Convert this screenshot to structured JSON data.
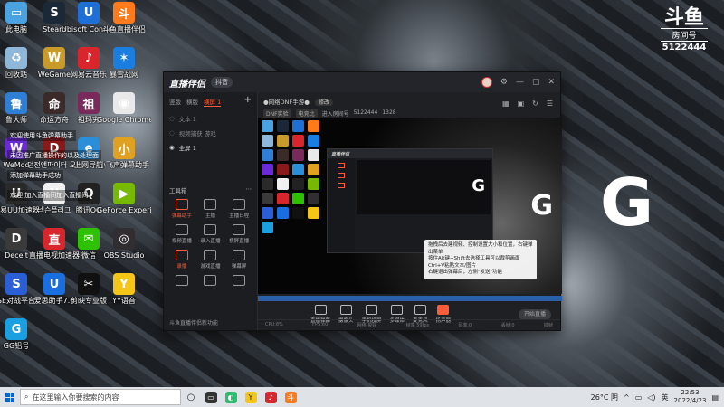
{
  "desktop_icons": [
    {
      "label": "此电脑",
      "glyph": "▭",
      "color": "#4aa3e0"
    },
    {
      "label": "Steam",
      "glyph": "S",
      "color": "#1b2838"
    },
    {
      "label": "Ubisoft Connect",
      "glyph": "U",
      "color": "#1e6fd6"
    },
    {
      "label": "斗鱼直播伴侣",
      "glyph": "斗",
      "color": "#ff7a1a"
    },
    {
      "label": "回收站",
      "glyph": "♻",
      "color": "#8fb7d9"
    },
    {
      "label": "WeGame",
      "glyph": "W",
      "color": "#c79a2a"
    },
    {
      "label": "网易云音乐",
      "glyph": "♪",
      "color": "#d8262c"
    },
    {
      "label": "暴雪战网",
      "glyph": "✶",
      "color": "#1a7ee0"
    },
    {
      "label": "鲁大师",
      "glyph": "鲁",
      "color": "#2f7fd6"
    },
    {
      "label": "命运方舟",
      "glyph": "命",
      "color": "#3a2a2a"
    },
    {
      "label": "祖玛究",
      "glyph": "祖",
      "color": "#7a2a5a"
    },
    {
      "label": "Google Chrome",
      "glyph": "◉",
      "color": "#e9e9e9"
    },
    {
      "label": "WeMod",
      "glyph": "W",
      "color": "#6a2ad8"
    },
    {
      "label": "던전앤파이터 오버잘",
      "glyph": "D",
      "color": "#8a1a1a"
    },
    {
      "label": "上网导航",
      "glyph": "e",
      "color": "#2a8fd8"
    },
    {
      "label": "小飞声弹幕助手",
      "glyph": "小",
      "color": "#e0a020"
    },
    {
      "label": "网易UU加速器",
      "glyph": "U",
      "color": "#2a2a2a"
    },
    {
      "label": "넥슨플러그",
      "glyph": "N",
      "color": "#f0f0f0"
    },
    {
      "label": "腾讯QQ",
      "glyph": "Q",
      "color": "#222222"
    },
    {
      "label": "GeForce Experience",
      "glyph": "▶",
      "color": "#76b900"
    },
    {
      "label": "Deceit",
      "glyph": "D",
      "color": "#3a3a3a"
    },
    {
      "label": "直播电视加速器",
      "glyph": "直",
      "color": "#d8262c"
    },
    {
      "label": "微信",
      "glyph": "✉",
      "color": "#2dc100"
    },
    {
      "label": "OBS Studio",
      "glyph": "◎",
      "color": "#302e31"
    },
    {
      "label": "SE对战平台",
      "glyph": "S",
      "color": "#2a5fd8"
    },
    {
      "label": "爱思助手7.0",
      "glyph": "U",
      "color": "#1a6fe0"
    },
    {
      "label": "剪映专业版",
      "glyph": "✂",
      "color": "#111111"
    },
    {
      "label": "YY语音",
      "glyph": "Y",
      "color": "#f5c518"
    },
    {
      "label": "GG铝号",
      "glyph": "G",
      "color": "#1a9fe0"
    }
  ],
  "toasts": [
    "欢迎使用斗鱼弹幕助手",
    "未因推广直播操作的以及处理面",
    "添加弹幕助手成功",
    "欢迎    加入直播间加入直播间"
  ],
  "brand": {
    "logo": "斗鱼",
    "room_label": "房间号",
    "room_number": "5122444"
  },
  "app": {
    "title": "直播伴侣",
    "pill": "抖音",
    "tabs": [
      "竖版",
      "横版",
      "横屏 1"
    ],
    "scenes": [
      "文本 1",
      "视频捕获 游戏",
      "全屏 1"
    ],
    "tools_title": "工具箱",
    "tools": [
      {
        "label": "弹幕助手",
        "active": true
      },
      {
        "label": "主播",
        "active": false
      },
      {
        "label": "主播日程",
        "active": false
      },
      {
        "label": "视频直播",
        "active": false
      },
      {
        "label": "录入直播",
        "active": false
      },
      {
        "label": "横屏直播",
        "active": false
      },
      {
        "label": "录播",
        "active": true
      },
      {
        "label": "游戏直播",
        "active": false
      },
      {
        "label": "弹幕屏",
        "active": false
      },
      {
        "label": "",
        "active": false
      },
      {
        "label": "",
        "active": false
      },
      {
        "label": "",
        "active": false
      }
    ],
    "footer": "斗鱼直播伴侣新功能",
    "room_title": "●网络DNF手游●",
    "room_edit": "修改",
    "info": {
      "tag1": "DNF实验",
      "tag2": "电竞比",
      "line": "进入房间号",
      "room_id": "5122444",
      "count": "1328"
    },
    "tip_lines": [
      "拖拽后去建视频、控制设置大小和位置，右键弹出菜单",
      "按住Alt键+Shift去选择工具可以裁剪画面",
      "Ctrl+V粘贴文本/图片",
      "右键退出弹幕后，左侧\"发送\"功能"
    ],
    "controls": [
      "直播弹幕",
      "摄像头",
      "手机投屏",
      "多媒体",
      "麦克风",
      "扬声器"
    ],
    "live_button": "开始直播",
    "status": [
      "CPU:8%",
      "FPS:60",
      "网络:良好",
      "帧率 59fps",
      "码率:0",
      "丢帧:0",
      "掉帧"
    ]
  },
  "big_mark": "G",
  "taskbar": {
    "search_placeholder": "在这里输入你要搜索的内容",
    "weather": "26°C 阴",
    "time": "22:53",
    "date": "2022/4/23",
    "lang": "英"
  }
}
